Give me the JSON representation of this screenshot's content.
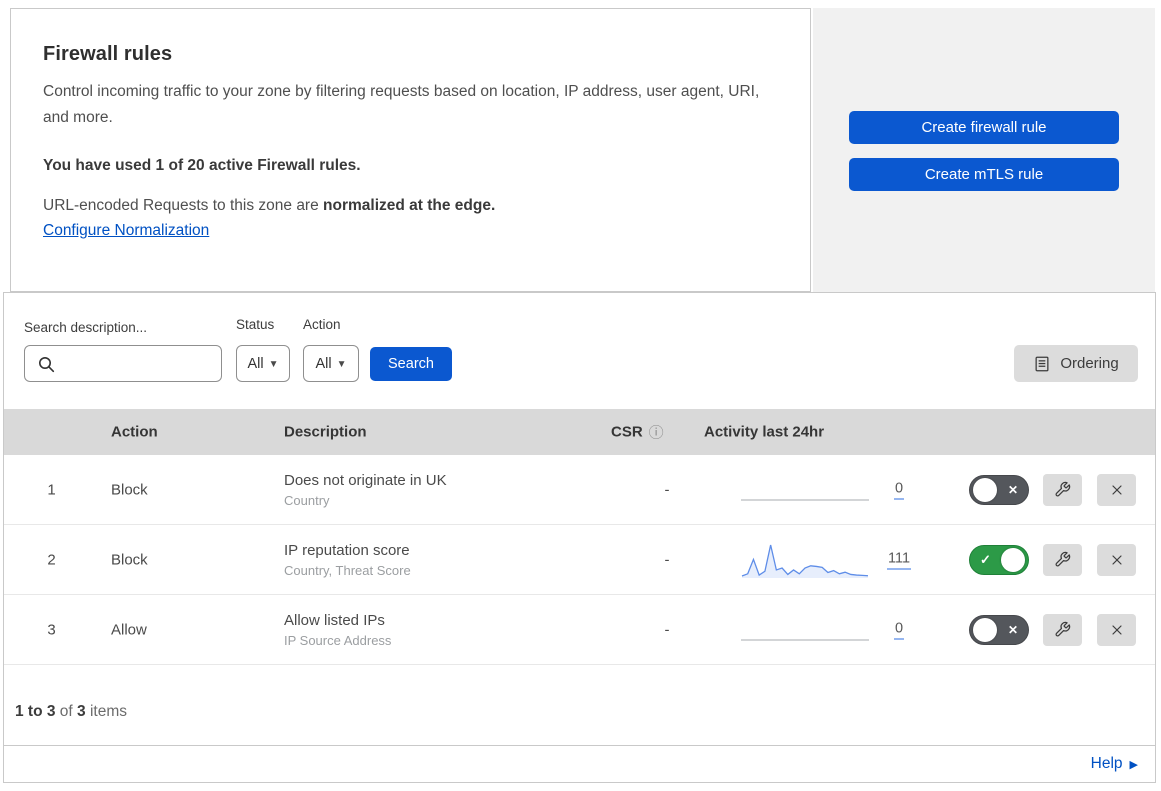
{
  "header": {
    "title": "Firewall rules",
    "description": "Control incoming traffic to your zone by filtering requests based on location, IP address, user agent, URI, and more.",
    "usage": "You have used 1 of 20 active Firewall rules.",
    "normalization_prefix": "URL-encoded Requests to this zone are ",
    "normalization_bold": "normalized at the edge.",
    "normalization_link": "Configure Normalization",
    "buttons": [
      {
        "label": "Create firewall rule"
      },
      {
        "label": "Create mTLS rule"
      }
    ]
  },
  "filters": {
    "search_label": "Search description...",
    "status_label": "Status",
    "status_value": "All",
    "action_label": "Action",
    "action_value": "All",
    "search_button": "Search",
    "ordering_button": "Ordering"
  },
  "table": {
    "columns": {
      "action": "Action",
      "description": "Description",
      "csr": "CSR",
      "activity": "Activity last 24hr"
    },
    "rows": [
      {
        "priority": "1",
        "action": "Block",
        "description": "Does not originate in UK",
        "criteria": "Country",
        "csr": "-",
        "activity_count": "0",
        "enabled": false,
        "sparkline": []
      },
      {
        "priority": "2",
        "action": "Block",
        "description": "IP reputation score",
        "criteria": "Country, Threat Score",
        "csr": "-",
        "activity_count": "111",
        "enabled": true,
        "sparkline": [
          3,
          10,
          55,
          6,
          18,
          100,
          22,
          28,
          8,
          22,
          10,
          28,
          35,
          33,
          30,
          14,
          20,
          10,
          15,
          8,
          6,
          5,
          4
        ]
      },
      {
        "priority": "3",
        "action": "Allow",
        "description": "Allow listed IPs",
        "criteria": "IP Source Address",
        "csr": "-",
        "activity_count": "0",
        "enabled": false,
        "sparkline": []
      }
    ]
  },
  "pagination": {
    "range": "1 to 3",
    "of": " of ",
    "total": "3",
    "items": " items"
  },
  "footer": {
    "help": "Help"
  },
  "icons": {
    "check": "✓",
    "cross": "✕",
    "chevron_down": "▼",
    "info": "ⓘ",
    "help_arrow": "▶"
  },
  "colors": {
    "accent_blue": "#0b58d0",
    "link_blue": "#0051c3",
    "toggle_on_green": "#2c9a47",
    "toggle_off_gray": "#54575c",
    "sparkline_blue": "#5e8de8",
    "sparkline_flat_gray": "#b9bcbf",
    "header_row_bg": "#d9d9d9",
    "panel_gray": "#f1f1f1"
  }
}
